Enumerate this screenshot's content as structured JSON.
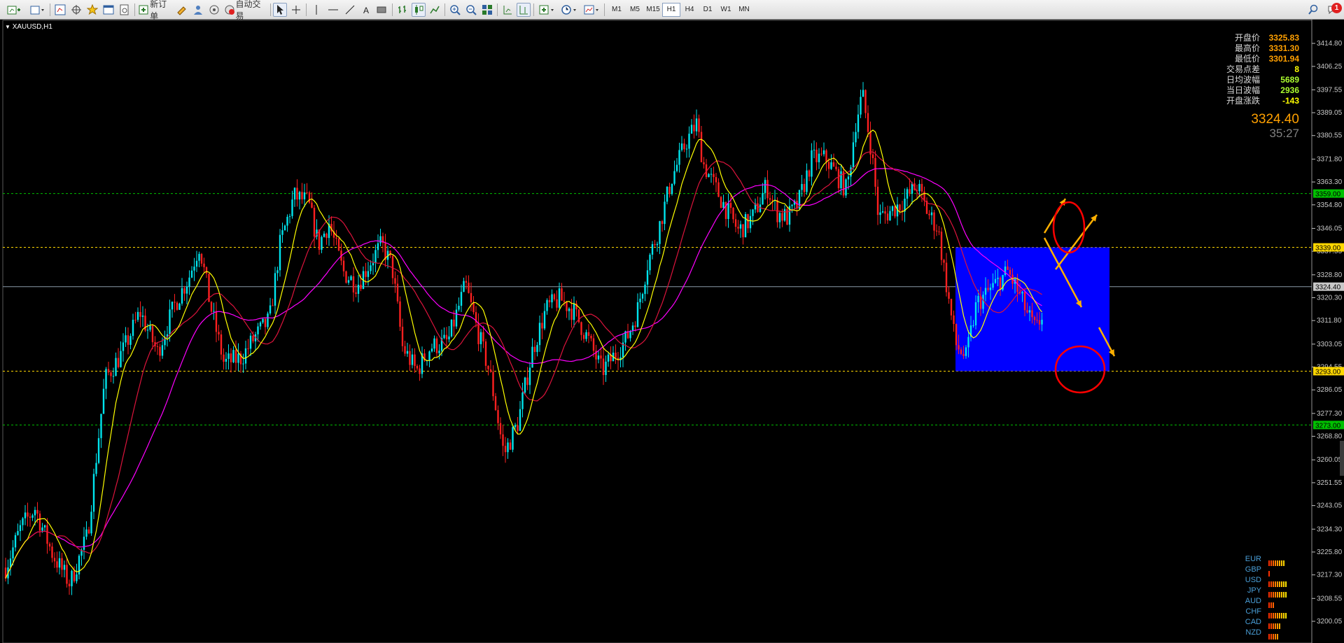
{
  "toolbar": {
    "new_order_label": "新订单",
    "auto_trading_label": "自动交易",
    "timeframes": [
      "M1",
      "M5",
      "M15",
      "H1",
      "H4",
      "D1",
      "W1",
      "MN"
    ],
    "selected_timeframe": "H1",
    "notification_count": "1"
  },
  "chart": {
    "symbol_title": "XAUUSD,H1",
    "current_price_big": "3324.40",
    "countdown": "35:27",
    "info_panel": [
      {
        "label": "开盘价",
        "value": "3325.83",
        "color": "#ffa000"
      },
      {
        "label": "最高价",
        "value": "3331.30",
        "color": "#ffa000"
      },
      {
        "label": "最低价",
        "value": "3301.94",
        "color": "#ffa000"
      },
      {
        "label": "交易点差",
        "value": "8",
        "color": "#ffff00"
      },
      {
        "label": "日均波幅",
        "value": "5689",
        "color": "#adff2f"
      },
      {
        "label": "当日波幅",
        "value": "2936",
        "color": "#adff2f"
      },
      {
        "label": "开盘涨跌",
        "value": "-143",
        "color": "#ffff00"
      }
    ],
    "price_axis_ticks": [
      "3414.80",
      "3406.25",
      "3397.55",
      "3389.05",
      "3380.55",
      "3371.80",
      "3363.30",
      "3354.80",
      "3346.05",
      "3337.55",
      "3328.80",
      "3320.30",
      "3311.80",
      "3303.05",
      "3294.55",
      "3286.05",
      "3277.30",
      "3268.80",
      "3260.05",
      "3251.55",
      "3243.05",
      "3234.30",
      "3225.80",
      "3217.30",
      "3208.55",
      "3200.05"
    ],
    "level_labels": [
      {
        "value": "3359.00",
        "bg": "#00c000",
        "fg": "#000000"
      },
      {
        "value": "3339.00",
        "bg": "#ffd700",
        "fg": "#000000"
      },
      {
        "value": "3324.40",
        "bg": "#c8c8c8",
        "fg": "#000000"
      },
      {
        "value": "3293.00",
        "bg": "#ffd700",
        "fg": "#000000"
      },
      {
        "value": "3273.00",
        "bg": "#00c000",
        "fg": "#000000"
      }
    ],
    "colors": {
      "bull_candle": "#00e5ee",
      "bear_candle": "#ff2020",
      "ma_fast": "#ffff00",
      "ma_mid": "#dc143c",
      "ma_slow": "#ff00ff",
      "support_resistance": "#ffd700",
      "outer_levels": "#00c000",
      "zone_fill": "#0000ff",
      "arrow": "#ffb000",
      "circle": "#ff0000"
    }
  },
  "currency_strength": [
    {
      "ccy": "EUR",
      "level": 8
    },
    {
      "ccy": "GBP",
      "level": 1
    },
    {
      "ccy": "USD",
      "level": 9
    },
    {
      "ccy": "JPY",
      "level": 9
    },
    {
      "ccy": "AUD",
      "level": 3
    },
    {
      "ccy": "CHF",
      "level": 9
    },
    {
      "ccy": "CAD",
      "level": 6
    },
    {
      "ccy": "NZD",
      "level": 5
    }
  ]
}
